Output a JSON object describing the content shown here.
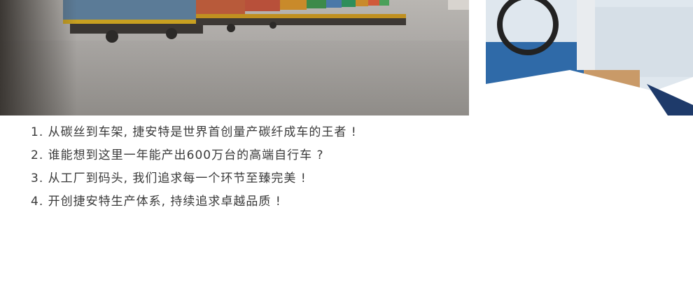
{
  "items": [
    "1. 从碳丝到车架, 捷安特是世界首创量产碳纤成车的王者 !",
    "2. 谁能想到这里一年能产出600万台的高端自行车 ?",
    "3. 从工厂到码头, 我们追求每一个环节至臻完美 !",
    "4. 开创捷安特生产体系, 持续追求卓越品质 !"
  ]
}
